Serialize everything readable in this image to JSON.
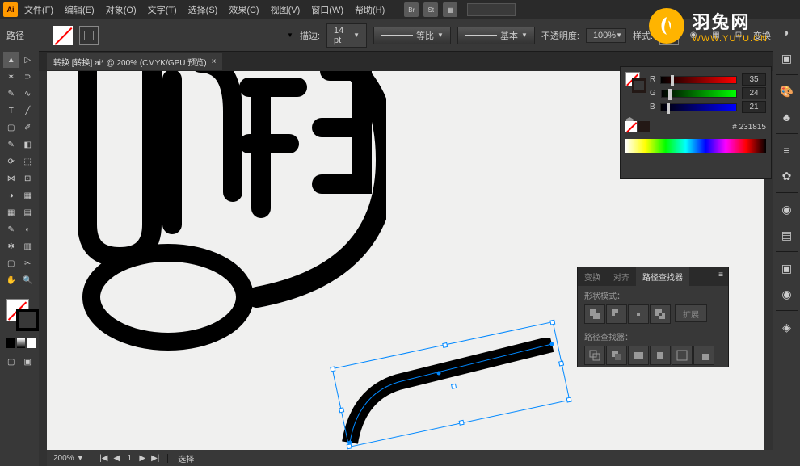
{
  "menu": {
    "file": "文件(F)",
    "edit": "编辑(E)",
    "object": "对象(O)",
    "text": "文字(T)",
    "select": "选择(S)",
    "effect": "效果(C)",
    "view": "视图(V)",
    "window": "窗口(W)",
    "help": "帮助(H)"
  },
  "topicons": {
    "br": "Br",
    "st": "St"
  },
  "control": {
    "path_label": "路径",
    "stroke_label": "描边:",
    "stroke_width": "14 pt",
    "stroke_profile": "等比",
    "brush": "基本",
    "opacity_label": "不透明度:",
    "opacity": "100%",
    "style_label": "样式:",
    "transform": "变换"
  },
  "tab": {
    "title": "转换 [转换].ai* @ 200% (CMYK/GPU 预览)"
  },
  "color": {
    "r_label": "R",
    "r_val": "35",
    "g_label": "G",
    "g_val": "24",
    "b_label": "B",
    "b_val": "21",
    "hex": "231815"
  },
  "pathfinder": {
    "tab1": "变换",
    "tab2": "对齐",
    "tab3": "路径查找器",
    "shape_modes": "形状模式：",
    "expand": "扩展",
    "pathfinders": "路径查找器："
  },
  "status": {
    "zoom": "200%",
    "page": "1",
    "tool": "选择"
  },
  "watermark": {
    "cn": "羽兔网",
    "url": "WWW.YUTU.CN"
  }
}
